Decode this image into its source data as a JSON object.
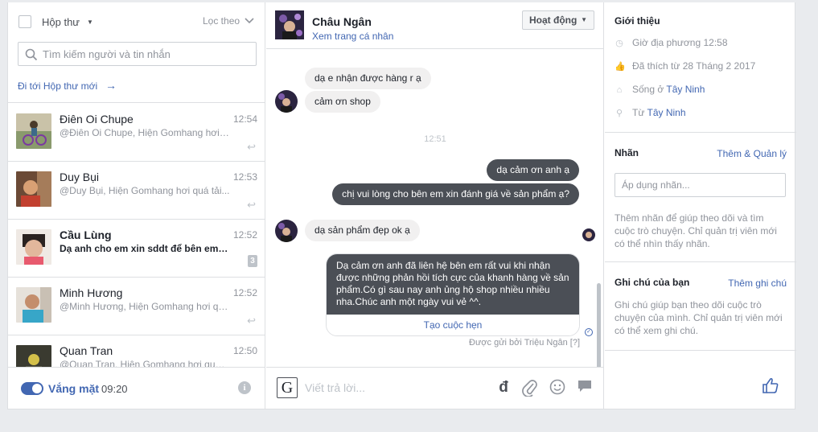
{
  "left": {
    "inbox_label": "Hộp thư",
    "filter_label": "Lọc theo",
    "search_placeholder": "Tìm kiếm người và tin nhắn",
    "goto_new_inbox": "Đi tới Hộp thư mới",
    "conversations": [
      {
        "name": "Điên Oi Chupe",
        "time": "12:54",
        "preview": "@Điên Oi Chupe, Hiện Gomhang hơi quá tải...",
        "unread": false
      },
      {
        "name": "Duy Bụi",
        "time": "12:53",
        "preview": "@Duy Bụi, Hiện Gomhang hơi quá tải...",
        "unread": false
      },
      {
        "name": "Cầu Lùng",
        "time": "12:52",
        "preview": "Dạ anh cho em xin sddt để bên em liên hệ",
        "unread": true,
        "badge": "3"
      },
      {
        "name": "Minh Hương",
        "time": "12:52",
        "preview": "@Minh Hương, Hiện Gomhang hơi quá tải...",
        "unread": false
      },
      {
        "name": "Quan Tran",
        "time": "12:50",
        "preview": "@Quan Tran, Hiện Gomhang hơi quá tải...",
        "unread": false
      }
    ],
    "away_label": "Vắng mặt",
    "away_time": "09:20"
  },
  "thread": {
    "contact_name": "Châu Ngân",
    "view_profile": "Xem trang cá nhân",
    "activity_button": "Hoạt động",
    "messages": {
      "in1": "dạ e nhận được hàng r ạ",
      "in2": "cảm ơn shop",
      "timestamp": "12:51",
      "out1": "dạ cảm ơn anh ạ",
      "out2": "chị vui lòng cho bên em xin đánh giá về sản phẩm ạ?",
      "in3": "dạ sản phẩm đẹp ok ạ",
      "card_text": "Dạ cảm ơn anh đã liên hệ bên em rất vui khi nhận được những phản hồi tích cực của khanh hàng về sản phẩm.Có gì sau nay anh ủng hộ shop nhiều nhiều nha.Chúc anh một ngày vui vẻ ^^.",
      "card_button": "Tạo cuộc hẹn"
    },
    "sent_by": "Được gửi bởi Triệu Ngân",
    "sent_by_help": "[?]",
    "reply_placeholder": "Viết trả lời..."
  },
  "right": {
    "intro_title": "Giới thiệu",
    "intro": {
      "local_time": "Giờ địa phương 12:58",
      "liked_since": "Đã thích từ 28 Tháng 2 2017",
      "lives_prefix": "Sống ở",
      "lives_place": "Tây Ninh",
      "from_prefix": "Từ",
      "from_place": "Tây Ninh"
    },
    "labels_title": "Nhãn",
    "labels_link": "Thêm & Quản lý",
    "labels_placeholder": "Áp dụng nhãn...",
    "labels_desc": "Thêm nhãn để giúp theo dõi và tìm cuộc trò chuyện. Chỉ quản trị viên mới có thể nhìn thấy nhãn.",
    "notes_title": "Ghi chú của bạn",
    "notes_link": "Thêm ghi chú",
    "notes_desc": "Ghi chú giúp bạn theo dõi cuộc trò chuyện của mình. Chỉ quản trị viên mới có thể xem ghi chú."
  },
  "colors": {
    "accent": "#4267b2",
    "outgoing_bubble": "#4b4f56",
    "incoming_bubble": "#f1f0f0"
  }
}
